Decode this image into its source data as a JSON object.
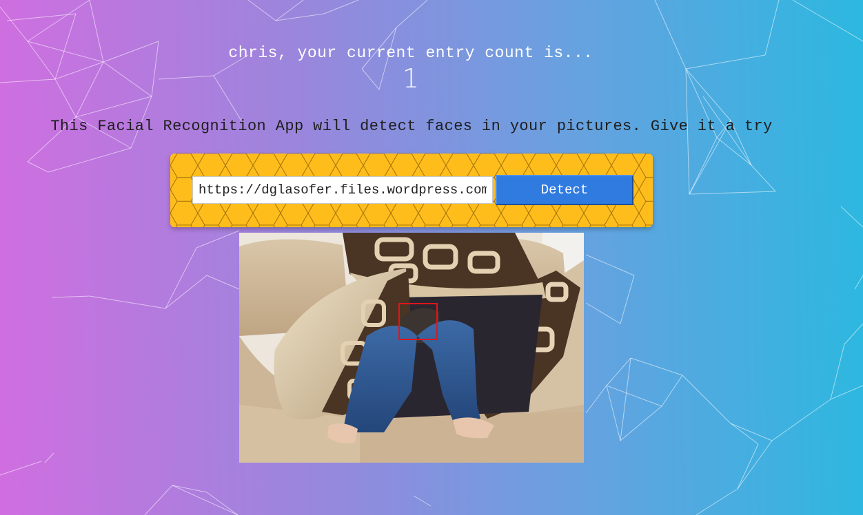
{
  "header": {
    "greeting": "chris, your current entry count is...",
    "entry_count": "1"
  },
  "intro_text": "This Facial Recognition App will detect faces in your pictures. Give it a try",
  "form": {
    "url_value": "https://dglasofer.files.wordpress.com",
    "detect_label": "Detect"
  },
  "colors": {
    "background_gradient_left": "#d06ee0",
    "background_gradient_right": "#2cb8e0",
    "form_panel": "#ffbd1c",
    "detect_button": "#2f7be0",
    "face_box": "#e0151b"
  },
  "icons": {
    "background": "particle-network-pattern",
    "panel": "honeycomb-pattern"
  }
}
